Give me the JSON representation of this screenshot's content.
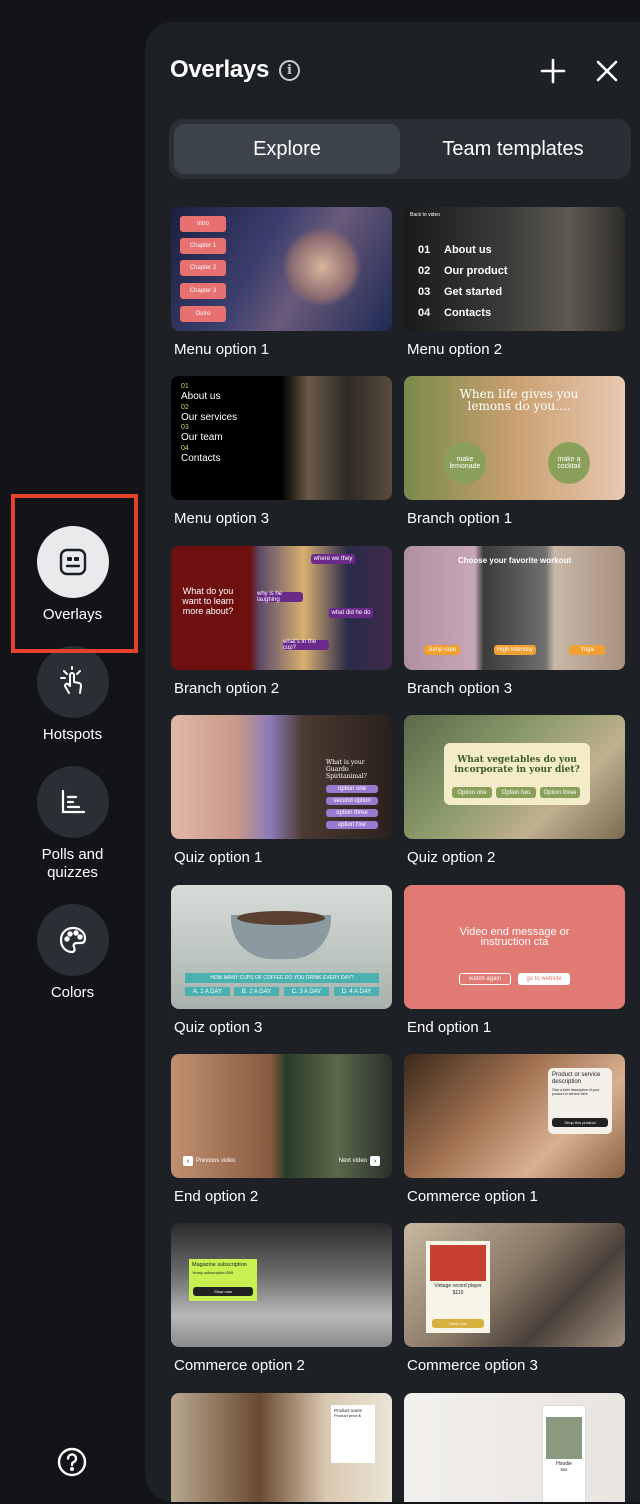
{
  "rail": {
    "items": [
      {
        "label": "Overlays",
        "icon": "overlays-icon"
      },
      {
        "label": "Hotspots",
        "icon": "pointer-tap-icon"
      },
      {
        "label": "Polls and quizzes",
        "icon": "bar-chart-icon"
      },
      {
        "label": "Colors",
        "icon": "palette-icon"
      }
    ],
    "help_icon": "help-circle-icon"
  },
  "panel": {
    "title": "Overlays",
    "info_icon": "info-icon",
    "add_icon": "plus-icon",
    "close_icon": "close-icon",
    "tabs": [
      {
        "label": "Explore",
        "active": true
      },
      {
        "label": "Team templates",
        "active": false
      }
    ]
  },
  "cards": [
    {
      "label": "Menu option 1"
    },
    {
      "label": "Menu option 2"
    },
    {
      "label": "Menu option 3"
    },
    {
      "label": "Branch option 1"
    },
    {
      "label": "Branch option 2"
    },
    {
      "label": "Branch option 3"
    },
    {
      "label": "Quiz option 1"
    },
    {
      "label": "Quiz option 2"
    },
    {
      "label": "Quiz option 3"
    },
    {
      "label": "End option 1"
    },
    {
      "label": "End option 2"
    },
    {
      "label": "Commerce option 1"
    },
    {
      "label": "Commerce option 2"
    },
    {
      "label": "Commerce option 3"
    },
    {
      "label": ""
    },
    {
      "label": ""
    }
  ],
  "thumb_text": {
    "menu1": [
      "Intro",
      "Chapter 1",
      "Chapter 2",
      "Chapter 3",
      "Outro"
    ],
    "menu2": {
      "back": "Back to video",
      "items": [
        {
          "num": "01",
          "text": "About us"
        },
        {
          "num": "02",
          "text": "Our product"
        },
        {
          "num": "03",
          "text": "Get started"
        },
        {
          "num": "04",
          "text": "Contacts"
        }
      ]
    },
    "menu3": [
      {
        "num": "01",
        "text": "About us"
      },
      {
        "num": "02",
        "text": "Our services"
      },
      {
        "num": "03",
        "text": "Our team"
      },
      {
        "num": "04",
        "text": "Contacts"
      }
    ],
    "branch1": {
      "headline": "When life gives you lemons do you....",
      "a": "make lemonade",
      "b": "make a cocktail"
    },
    "branch2": {
      "question": "What do you want to learn more about?",
      "chips": [
        "where we they",
        "why is he laughing",
        "what did he do",
        "what's in the cup?"
      ]
    },
    "branch3": {
      "headline": "Choose your favorite workout",
      "chips": [
        "Jump rope",
        "High intensity",
        "Yoga"
      ]
    },
    "quiz1": {
      "question": "What is your Guardo Spiritanimal?",
      "options": [
        "option one",
        "second option",
        "option three",
        "option four"
      ]
    },
    "quiz2": {
      "question": "What vegetables do you incorporate in your diet?",
      "options": [
        "Option one",
        "Option two",
        "Option three"
      ]
    },
    "quiz3": {
      "question": "HOW MANY CUPS OF COFFEE DO YOU DRINK EVERY DAY?",
      "options": [
        "A. 1 A DAY",
        "B. 2 A DAY",
        "C. 3 A DAY",
        "D. 4 A DAY"
      ]
    },
    "end1": {
      "message": "Video end message or instruction cta",
      "a": "watch again",
      "b": "go to website"
    },
    "end2": {
      "prev": "Previous video",
      "next": "Next video"
    },
    "commerce1": {
      "title": "Product or service description",
      "body": "Give a brief description of your product or service here",
      "cta": "Shop this product"
    },
    "commerce2": {
      "title": "Magazine subscription",
      "sub": "Yearly subscription $99",
      "cta": "Shop now"
    },
    "commerce3": {
      "title": "Vintage record player",
      "price": "$110",
      "cta": "Shop now"
    },
    "commerce4": {
      "title": "Product name",
      "price": "Product price $"
    },
    "commerce5": {
      "title": "Hoodie",
      "price": "$59"
    }
  },
  "colors": {
    "accent_red": "#e5412d",
    "panel_bg": "#1d2126",
    "rail_bg": "#121417"
  }
}
